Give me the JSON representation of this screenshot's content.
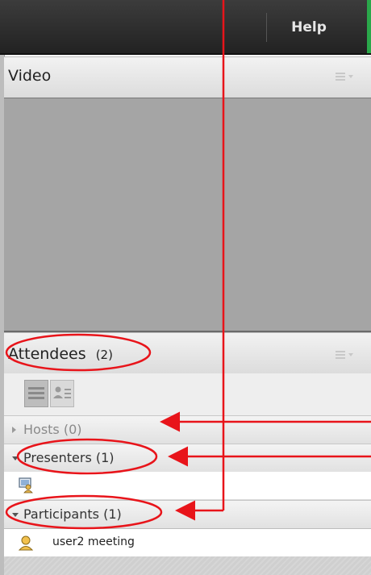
{
  "menubar": {
    "help_label": "Help"
  },
  "video_pod": {
    "title": "Video",
    "menu_icon": "pod-options-icon"
  },
  "attendees_pod": {
    "title": "Attendees",
    "count": "(2)",
    "menu_icon": "pod-options-icon",
    "view_buttons": [
      "list-view-icon",
      "person-view-icon"
    ],
    "groups": [
      {
        "label": "Hosts (0)",
        "expanded": false
      },
      {
        "label": "Presenters (1)",
        "expanded": true
      },
      {
        "label": "Participants (1)",
        "expanded": true
      }
    ],
    "presenter_row": {
      "name": "",
      "icon": "presenter-icon"
    },
    "participant_row": {
      "name": "user2 meeting",
      "icon": "user-icon"
    }
  },
  "annotation_colors": {
    "arrow": "#e8141a"
  }
}
